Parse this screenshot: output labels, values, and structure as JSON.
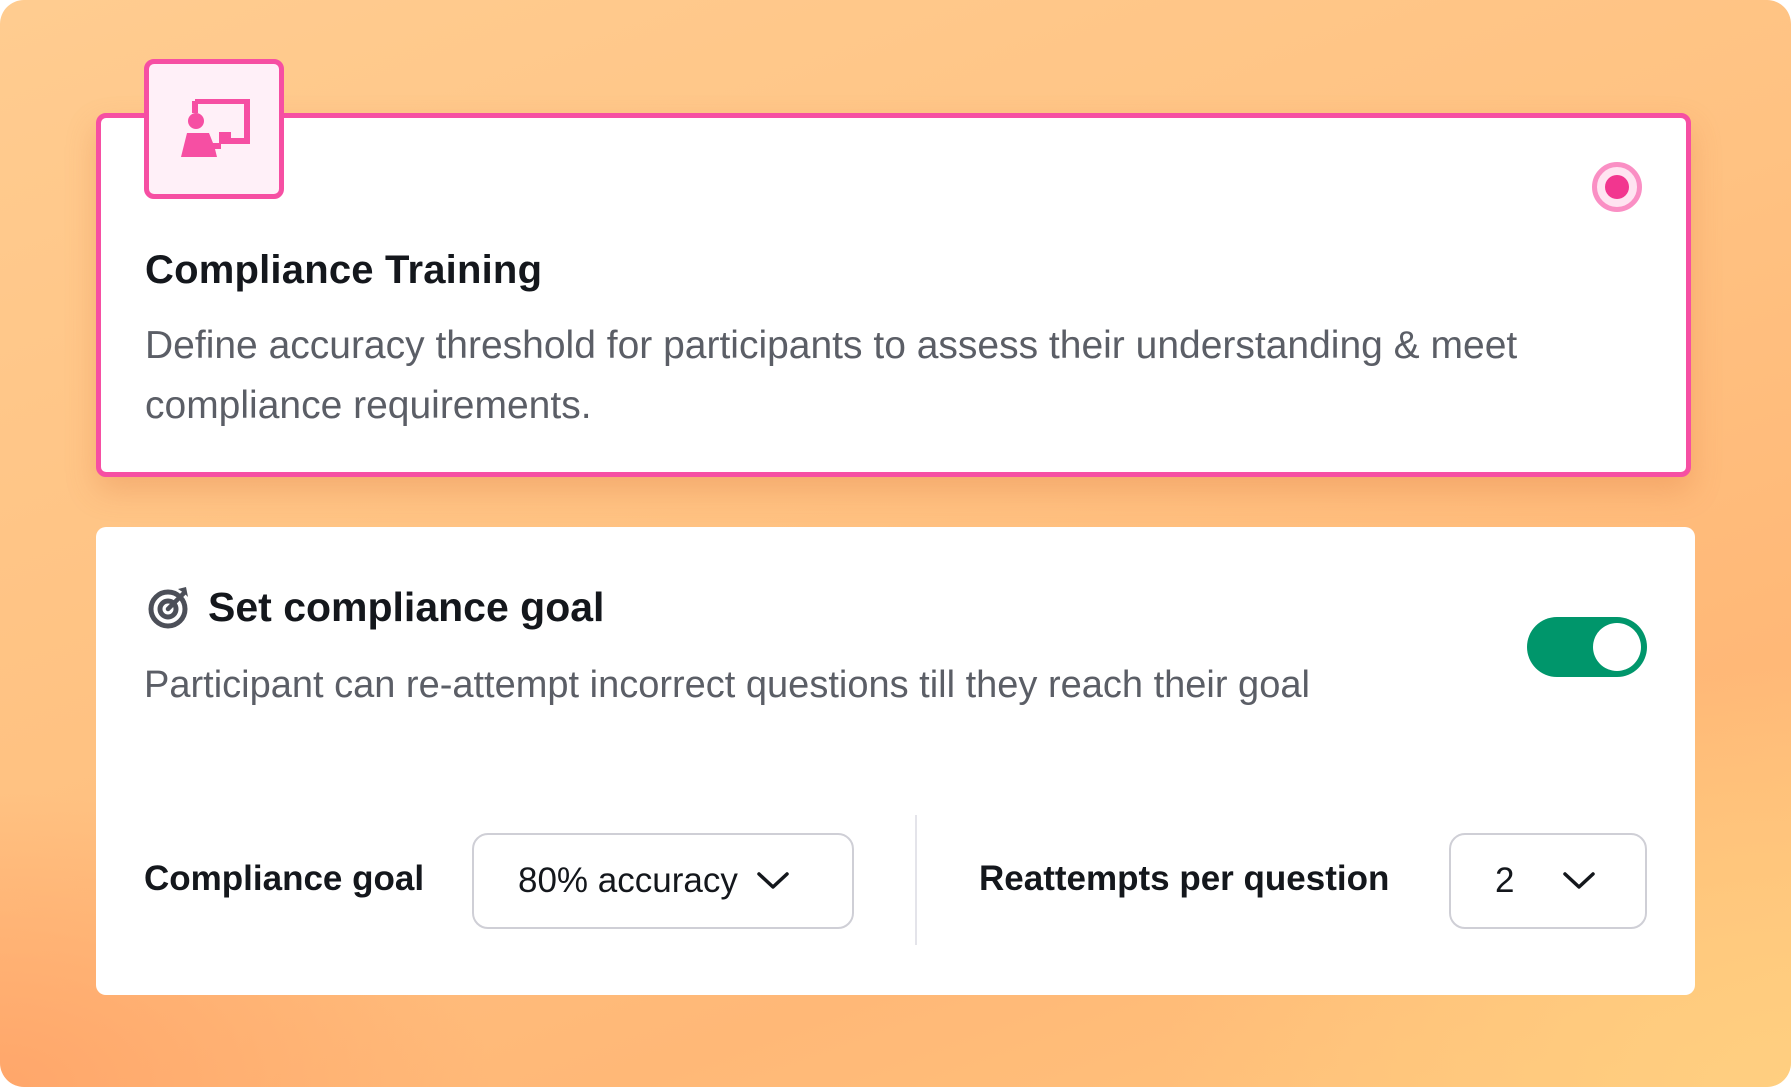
{
  "option_card": {
    "title": "Compliance Training",
    "description": "Define accuracy threshold for participants to assess their understanding & meet compliance requirements.",
    "selected": true,
    "icon": "presentation-icon",
    "accent_color": "#f64fa3"
  },
  "goal_panel": {
    "title": "Set compliance goal",
    "description": "Participant can re-attempt incorrect questions till they reach their goal",
    "icon": "target-icon",
    "toggle_on": true,
    "toggle_color": "#00966b",
    "compliance_goal": {
      "label": "Compliance goal",
      "value": "80% accuracy",
      "icon": "chevron-down-icon"
    },
    "reattempts": {
      "label": "Reattempts per question",
      "value": "2",
      "icon": "chevron-down-icon"
    }
  }
}
